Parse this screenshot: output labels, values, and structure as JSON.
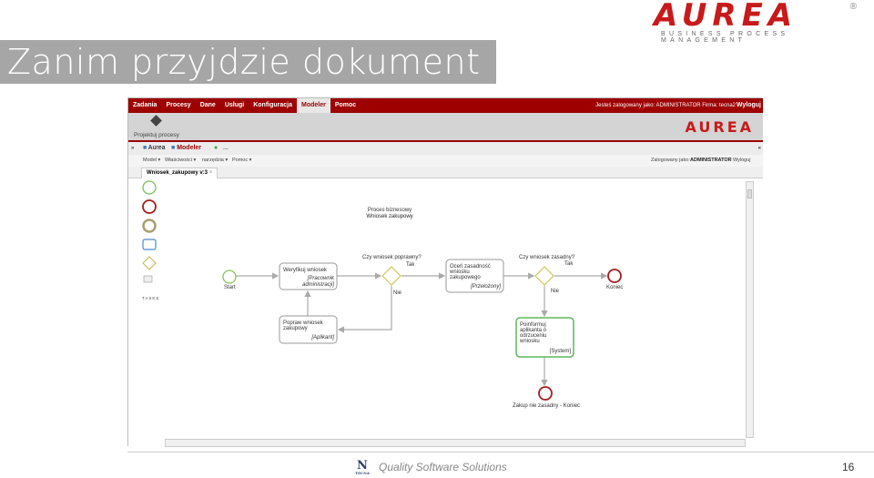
{
  "slide": {
    "title": "Zanim przyjdzie dokument",
    "footer_text": "Quality Software Solutions",
    "page_number": "16",
    "footer_logo": "TECNA"
  },
  "brand": {
    "logo": "AUREA",
    "tagline": "BUSINESS PROCESS MANAGEMENT",
    "reg": "®",
    "color": "#c81a1a"
  },
  "app": {
    "nav": {
      "items": [
        "Zadania",
        "Procesy",
        "Dane",
        "Usługi",
        "Konfiguracja",
        "Modeler",
        "Pomoc"
      ],
      "active": "Modeler",
      "user_info": "Jesteś zalogowany jako: ADMINISTRATOR Firma: tecna2",
      "logout": "Wyloguj",
      "color": "#9e0000"
    },
    "toolbar": {
      "design_button": "Projektuj procesy",
      "logo": "AUREA"
    },
    "tabs": {
      "items": [
        "Aurea",
        "Modeler"
      ],
      "more": "..."
    },
    "menu": {
      "items": [
        "Model ▾",
        "Właściwości ▾",
        "narzędzia ▾",
        "Pomoc ▾"
      ],
      "user_label": "Zalogowany jako:",
      "user": "ADMINISTRATOR",
      "logout": "Wyloguj"
    },
    "doc_tab": {
      "label": "Wniosek_zakupowy v:3",
      "close": "×"
    },
    "palette": {
      "tasks_label": "TASKS"
    },
    "diagram": {
      "pool_title": "Proces biznesowy",
      "pool_name": "Wniosek zakupowy",
      "start": "Start",
      "task1": {
        "name": "Weryfikuj wniosek",
        "role1": "[Pracownik",
        "role2": "administracji]"
      },
      "gw1": {
        "question": "Czy wniosek poprawny?",
        "yes": "Tak",
        "no": "Nie"
      },
      "task2": {
        "l1": "Oceń zasadność",
        "l2": "wniosku",
        "l3": "zakupowego",
        "role": "[Przełożony]"
      },
      "gw2": {
        "question": "Czy wniosek zasadny?",
        "yes": "Tak",
        "no": "Nie"
      },
      "end1": "Koniec",
      "task3": {
        "l1": "Popraw wniosek",
        "l2": "zakupowy",
        "role": "[Aplikant]"
      },
      "task4": {
        "l1": "Poinformuj",
        "l2": "aplikanta o",
        "l3": "odrzuceniu",
        "l4": "wniosku",
        "role": "[System]"
      },
      "end2": "Zakup nie zasadny - Koniec"
    }
  }
}
